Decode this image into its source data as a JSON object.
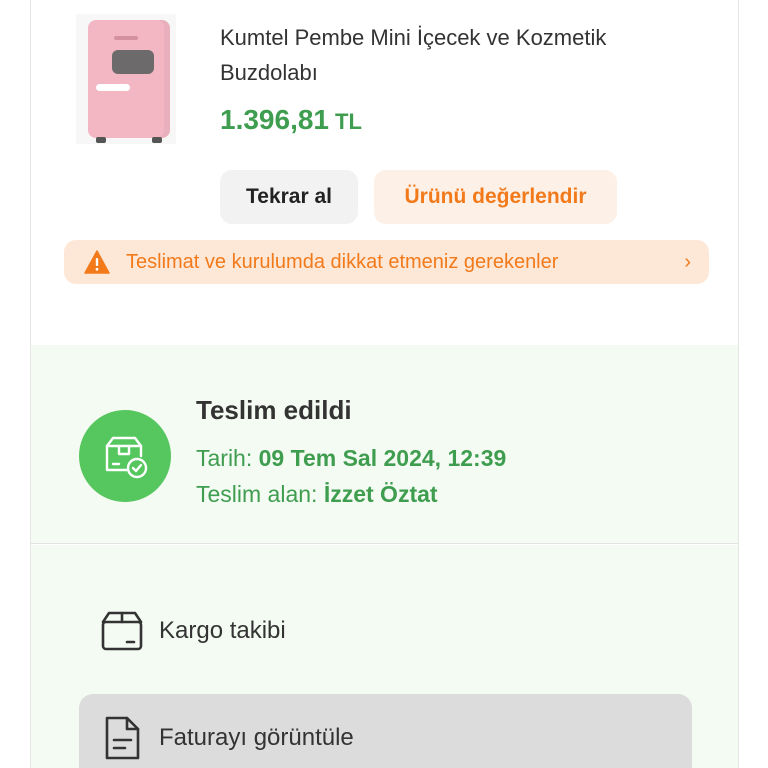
{
  "product": {
    "title": "Kumtel Pembe Mini İçecek ve Kozmetik Buzdolabı",
    "price": "1.396,81",
    "currency": "TL"
  },
  "buttons": {
    "rebuy": "Tekrar al",
    "review": "Ürünü değerlendir"
  },
  "warning": {
    "text": "Teslimat ve kurulumda dikkat etmeniz gerekenler",
    "chevron": "›"
  },
  "delivery": {
    "status": "Teslim edildi",
    "date_label": "Tarih:",
    "date_value": "09 Tem Sal 2024, 12:39",
    "recipient_label": "Teslim alan:",
    "recipient_value": "İzzet Öztat"
  },
  "actions": [
    {
      "label": "Kargo takibi",
      "icon": "package-icon"
    },
    {
      "label": "Faturayı görüntüle",
      "icon": "document-icon"
    }
  ],
  "colors": {
    "price_green": "#3f9d4f",
    "status_green": "#56c65e",
    "accent_orange": "#f27a1a",
    "warning_bg": "#fde7d7",
    "section_bg": "#f4fbf3"
  }
}
